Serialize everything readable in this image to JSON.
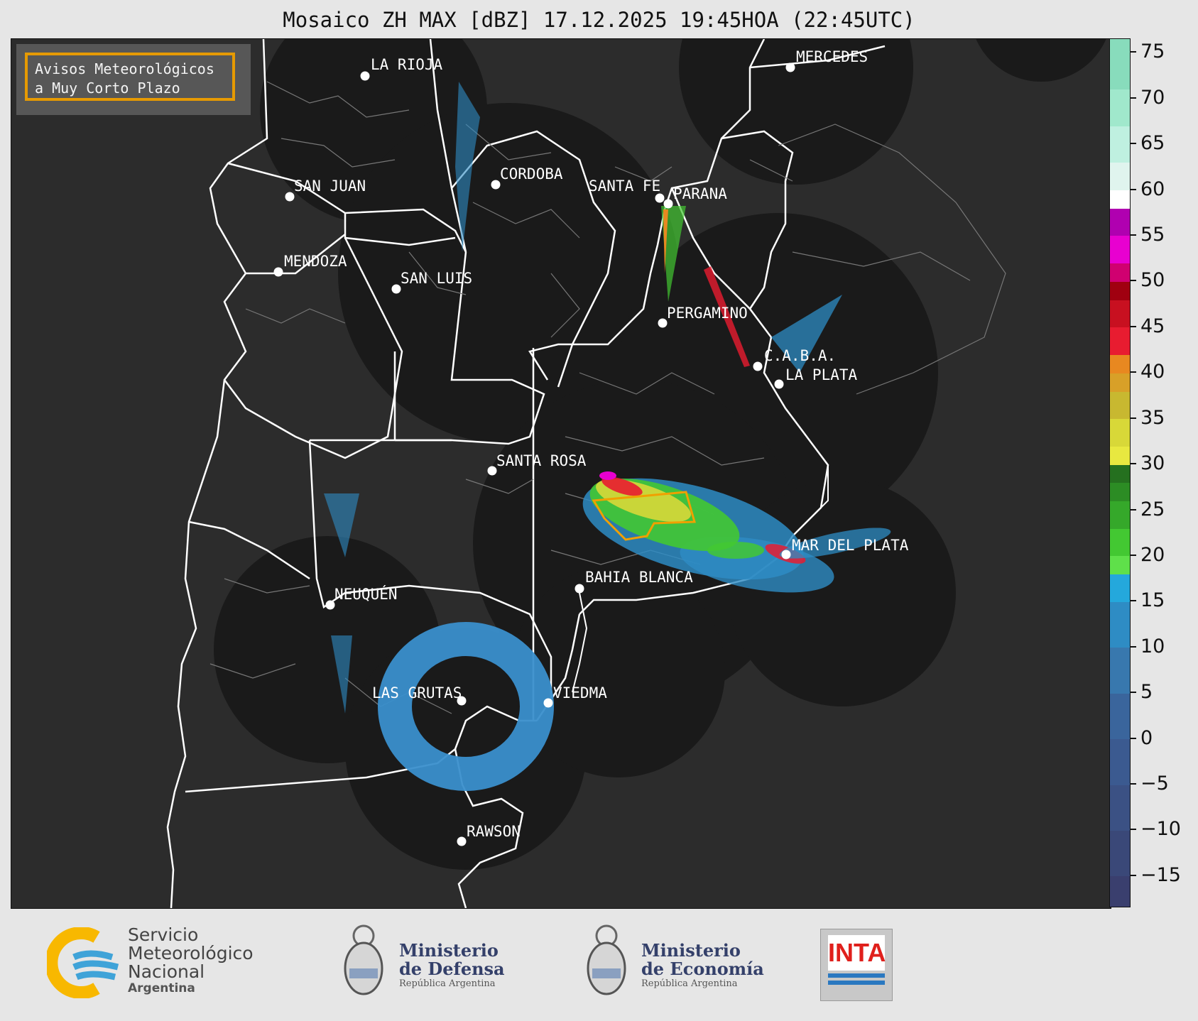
{
  "title": "Mosaico ZH MAX [dBZ] 17.12.2025 19:45HOA (22:45UTC)",
  "aviso": {
    "line1": "Avisos Meteorológicos",
    "line2": "a Muy Corto Plazo"
  },
  "cities": [
    {
      "name": "LA RIOJA",
      "id": "la-rioja"
    },
    {
      "name": "MERCEDES",
      "id": "mercedes"
    },
    {
      "name": "CORDOBA",
      "id": "cordoba"
    },
    {
      "name": "SAN JUAN",
      "id": "san-juan"
    },
    {
      "name": "SANTA FE",
      "id": "santa-fe"
    },
    {
      "name": "PARANA",
      "id": "parana"
    },
    {
      "name": "MENDOZA",
      "id": "mendoza"
    },
    {
      "name": "SAN LUIS",
      "id": "san-luis"
    },
    {
      "name": "PERGAMINO",
      "id": "pergamino"
    },
    {
      "name": "C.A.B.A.",
      "id": "caba"
    },
    {
      "name": "LA PLATA",
      "id": "la-plata"
    },
    {
      "name": "SANTA ROSA",
      "id": "santa-rosa"
    },
    {
      "name": "MAR DEL PLATA",
      "id": "mar-del-plata"
    },
    {
      "name": "BAHIA BLANCA",
      "id": "bahia-blanca"
    },
    {
      "name": "NEUQUÉN",
      "id": "neuquen"
    },
    {
      "name": "LAS GRUTAS",
      "id": "las-grutas"
    },
    {
      "name": "VIEDMA",
      "id": "viedma"
    },
    {
      "name": "RAWSON",
      "id": "rawson"
    }
  ],
  "colorbar": {
    "min": -18.5,
    "max": 76.5,
    "ticks": [
      "75",
      "70",
      "65",
      "60",
      "55",
      "50",
      "45",
      "40",
      "35",
      "30",
      "25",
      "20",
      "15",
      "10",
      "5",
      "0",
      "−5",
      "−10",
      "−15"
    ],
    "tick_values": [
      75,
      70,
      65,
      60,
      55,
      50,
      45,
      40,
      35,
      30,
      25,
      20,
      15,
      10,
      5,
      0,
      -5,
      -10,
      -15
    ],
    "colors": [
      {
        "from": -18.5,
        "to": -15,
        "color": "#3a3f6e"
      },
      {
        "from": -15,
        "to": -10,
        "color": "#3a4878"
      },
      {
        "from": -10,
        "to": -5,
        "color": "#3b5184"
      },
      {
        "from": -5,
        "to": 0,
        "color": "#3b5a90"
      },
      {
        "from": 0,
        "to": 5,
        "color": "#3a659c"
      },
      {
        "from": 5,
        "to": 10,
        "color": "#3878ae"
      },
      {
        "from": 10,
        "to": 15,
        "color": "#2e8cc4"
      },
      {
        "from": 15,
        "to": 18,
        "color": "#24a8dc"
      },
      {
        "from": 18,
        "to": 20,
        "color": "#5fe04a"
      },
      {
        "from": 20,
        "to": 23,
        "color": "#43c832"
      },
      {
        "from": 23,
        "to": 26,
        "color": "#35a82a"
      },
      {
        "from": 26,
        "to": 28,
        "color": "#2c8c24"
      },
      {
        "from": 28,
        "to": 30,
        "color": "#25701f"
      },
      {
        "from": 30,
        "to": 32,
        "color": "#e8e840"
      },
      {
        "from": 32,
        "to": 35,
        "color": "#d8d838"
      },
      {
        "from": 35,
        "to": 38,
        "color": "#c8b830"
      },
      {
        "from": 38,
        "to": 40,
        "color": "#d8a028"
      },
      {
        "from": 40,
        "to": 42,
        "color": "#e88820"
      },
      {
        "from": 42,
        "to": 45,
        "color": "#e81c30"
      },
      {
        "from": 45,
        "to": 48,
        "color": "#c81020"
      },
      {
        "from": 48,
        "to": 50,
        "color": "#a00010"
      },
      {
        "from": 50,
        "to": 52,
        "color": "#d00070"
      },
      {
        "from": 52,
        "to": 55,
        "color": "#e800d0"
      },
      {
        "from": 55,
        "to": 58,
        "color": "#b000b0"
      },
      {
        "from": 58,
        "to": 60,
        "color": "#ffffff"
      },
      {
        "from": 60,
        "to": 63,
        "color": "#e0f4ee"
      },
      {
        "from": 63,
        "to": 67,
        "color": "#bff0e0"
      },
      {
        "from": 67,
        "to": 71,
        "color": "#a0e8cc"
      },
      {
        "from": 71,
        "to": 76.5,
        "color": "#88dcbc"
      }
    ]
  },
  "footer": {
    "smn_line1": "Servicio",
    "smn_line2": "Meteorológico",
    "smn_line3": "Nacional",
    "smn_line4": "Argentina",
    "defensa_line1": "Ministerio",
    "defensa_line2": "de Defensa",
    "defensa_sub": "República Argentina",
    "economia_line1": "Ministerio",
    "economia_line2": "de Economía",
    "economia_sub": "República Argentina",
    "inta": "INTA"
  },
  "colors": {
    "map_bg": "#2c2c2c",
    "radar_coverage": "#1a1a1a",
    "warning_polygon": "#f0a000"
  }
}
